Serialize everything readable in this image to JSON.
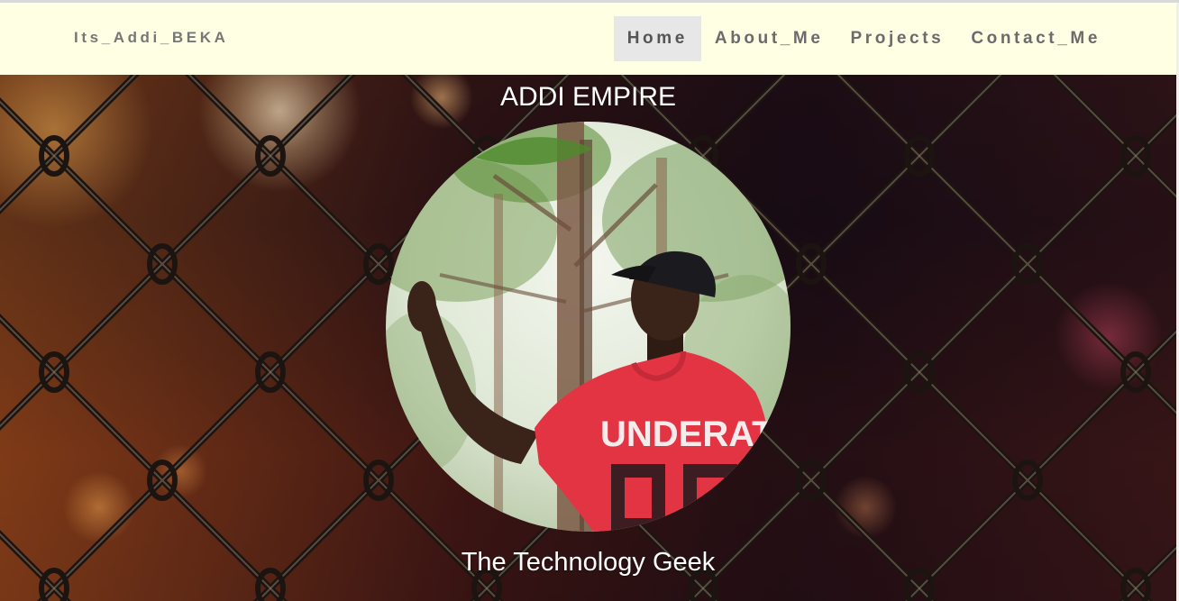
{
  "navbar": {
    "brand": "Its_Addi_BEKA",
    "items": [
      {
        "label": "Home",
        "active": true
      },
      {
        "label": "About_Me",
        "active": false
      },
      {
        "label": "Projects",
        "active": false
      },
      {
        "label": "Contact_Me",
        "active": false
      }
    ]
  },
  "hero": {
    "title": "ADDI EMPIRE",
    "subtitle": "The Technology Geek",
    "shirt_text": "UNDERATED"
  },
  "colors": {
    "navbar_bg": "#ffffe3",
    "nav_text": "#6b6b6b",
    "nav_active_bg": "#e7e7e7",
    "hero_text": "#ffffff"
  }
}
